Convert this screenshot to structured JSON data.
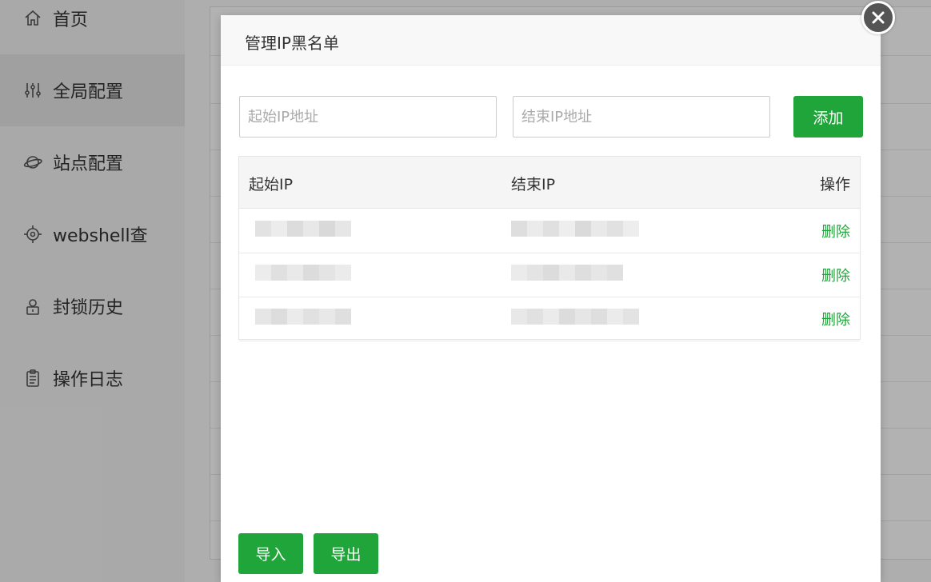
{
  "sidebar": {
    "items": [
      {
        "label": "首页",
        "icon": "home-icon"
      },
      {
        "label": "全局配置",
        "icon": "sliders-icon"
      },
      {
        "label": "站点配置",
        "icon": "planet-icon"
      },
      {
        "label": "webshell查",
        "icon": "target-icon"
      },
      {
        "label": "封锁历史",
        "icon": "lock-person-icon"
      },
      {
        "label": "操作日志",
        "icon": "clipboard-icon"
      }
    ],
    "active_index": 1
  },
  "modal": {
    "title": "管理IP黑名单",
    "start_ip_placeholder": "起始IP地址",
    "end_ip_placeholder": "结束IP地址",
    "add_label": "添加",
    "table": {
      "headers": [
        "起始IP",
        "结束IP",
        "操作"
      ],
      "rows": [
        {
          "start_ip": "",
          "end_ip": "",
          "action": "删除"
        },
        {
          "start_ip": "",
          "end_ip": "",
          "action": "删除"
        },
        {
          "start_ip": "",
          "end_ip": "",
          "action": "删除"
        }
      ]
    },
    "import_label": "导入",
    "export_label": "导出"
  },
  "colors": {
    "accent": "#20a53a",
    "overlay": "rgba(0,0,0,0.30)"
  }
}
